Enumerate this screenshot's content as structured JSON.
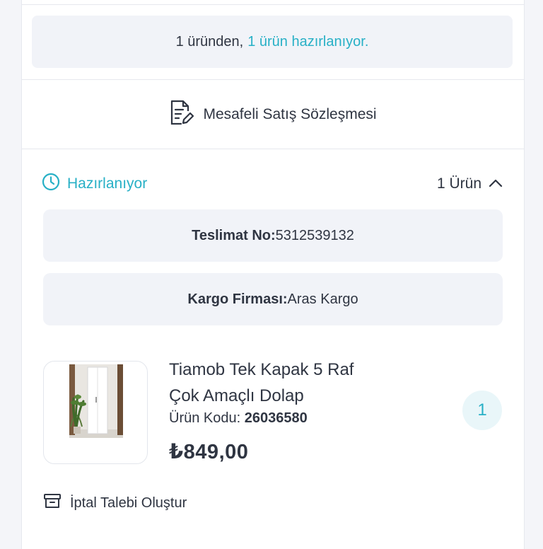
{
  "order_status": {
    "prefix": "1 üründen,",
    "highlight": "1 ürün hazırlanıyor."
  },
  "contract_link": {
    "label": "Mesafeli Satış Sözleşmesi",
    "icon": "document-edit-icon"
  },
  "shipment": {
    "status": "Hazırlanıyor",
    "status_icon": "clock-icon",
    "item_count": "1 Ürün",
    "toggle_icon": "chevron-up-icon",
    "delivery_label": "Teslimat No:",
    "delivery_value": "5312539132",
    "carrier_label": "Kargo Firması:",
    "carrier_value": "Aras Kargo"
  },
  "product": {
    "name_line1": "Tiamob Tek Kapak 5 Raf",
    "name_line2": "Çok Amaçlı Dolap",
    "code_label": "Ürün Kodu:",
    "code_value": "26036580",
    "price": "₺849,00",
    "quantity": "1"
  },
  "cancel_action": {
    "label": "İptal Talebi Oluştur",
    "icon": "box-icon"
  },
  "colors": {
    "accent": "#27b0c6",
    "text": "#2f3542",
    "panel": "#f1f3f8"
  }
}
